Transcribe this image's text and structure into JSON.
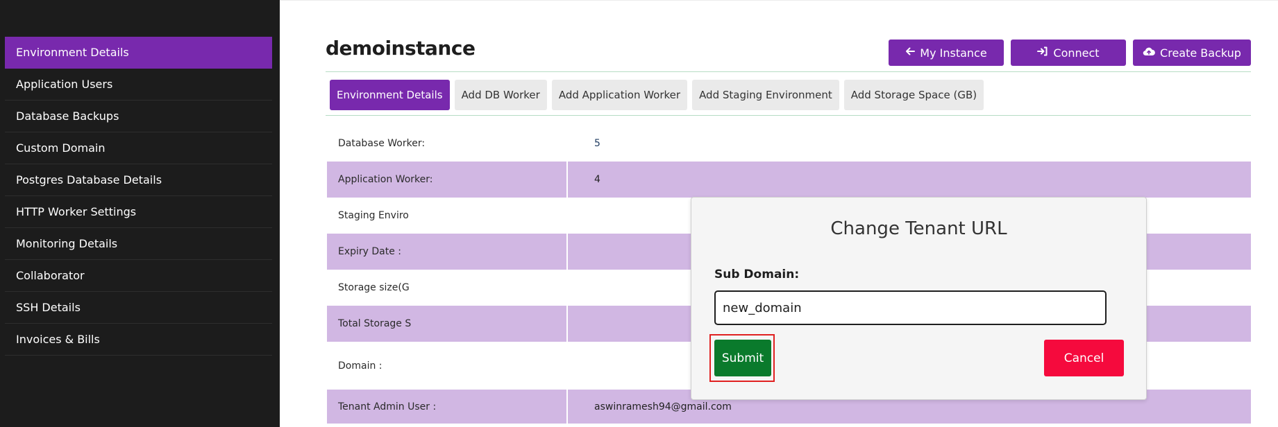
{
  "sidebar": {
    "items": [
      {
        "label": "Environment Details",
        "active": true
      },
      {
        "label": "Application Users"
      },
      {
        "label": "Database Backups"
      },
      {
        "label": "Custom Domain"
      },
      {
        "label": "Postgres Database Details"
      },
      {
        "label": "HTTP Worker Settings"
      },
      {
        "label": "Monitoring Details"
      },
      {
        "label": "Collaborator"
      },
      {
        "label": "SSH Details"
      },
      {
        "label": "Invoices & Bills"
      }
    ]
  },
  "header": {
    "title": "demoinstance",
    "buttons": {
      "my_instance": {
        "label": "My Instance",
        "icon": "arrow-left-icon"
      },
      "connect": {
        "label": "Connect",
        "icon": "sign-in-icon"
      },
      "create_backup": {
        "label": "Create Backup",
        "icon": "cloud-upload-icon"
      }
    }
  },
  "tabs": [
    {
      "label": "Environment Details",
      "active": true
    },
    {
      "label": "Add DB Worker"
    },
    {
      "label": "Add Application Worker"
    },
    {
      "label": "Add Staging Environment"
    },
    {
      "label": "Add Storage Space (GB)"
    }
  ],
  "details": [
    {
      "label": "Database Worker:",
      "value": "5"
    },
    {
      "label": "Application Worker:",
      "value": "4"
    },
    {
      "label": "Staging Enviro",
      "value": ""
    },
    {
      "label": "Expiry Date :",
      "value": ""
    },
    {
      "label": "Storage size(G",
      "value": ""
    },
    {
      "label": "Total Storage S",
      "value": ""
    },
    {
      "label": "Domain :",
      "value": ""
    },
    {
      "label": "Tenant Admin User :",
      "value": "aswinramesh94@gmail.com"
    }
  ],
  "modal": {
    "title": "Change Tenant URL",
    "field_label": "Sub Domain:",
    "field_value": "new_domain",
    "submit_label": "Submit",
    "cancel_label": "Cancel"
  },
  "colors": {
    "accent": "#7829ad",
    "row_shade": "#d1b7e3",
    "sidebar_bg": "#1c1c1c",
    "submit": "#0a7a2c",
    "cancel": "#f50a3d",
    "highlight": "#e02020"
  }
}
